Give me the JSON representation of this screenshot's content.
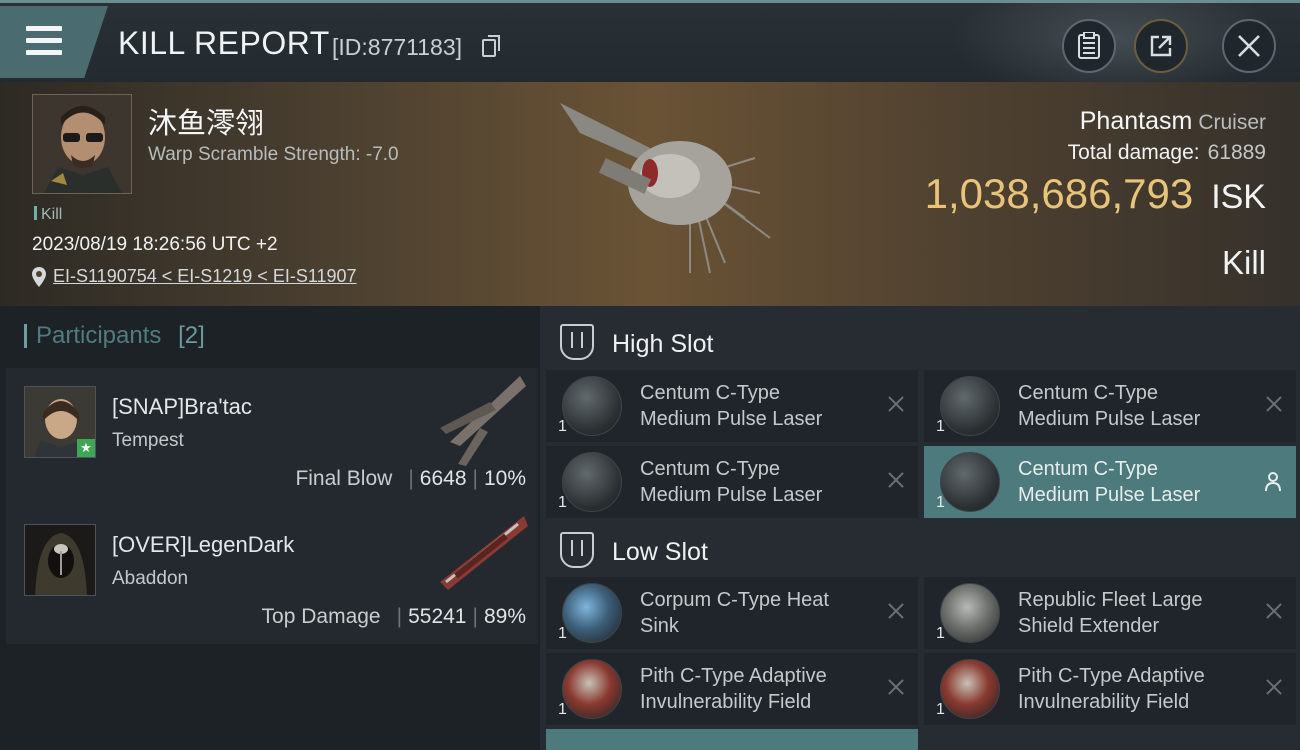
{
  "header": {
    "title": "KILL REPORT",
    "id_text": "[ID:8771183]",
    "icons": [
      "menu-icon",
      "clipboard-icon",
      "share-icon",
      "close-icon"
    ]
  },
  "victim": {
    "name": "沐鱼澪翎",
    "warp_scramble": "Warp Scramble Strength: -7.0",
    "tag": "Kill",
    "datetime": "2023/08/19 18:26:56 UTC +2",
    "location": "EI-S1190754 < EI-S1219 < EI-S11907",
    "ship": "Phantasm",
    "ship_class": "Cruiser",
    "total_damage_label": "Total damage:",
    "total_damage": "61889",
    "isk_value": "1,038,686,793",
    "isk_unit": "ISK",
    "result": "Kill"
  },
  "participants": {
    "label": "Participants",
    "count": "[2]",
    "rows": [
      {
        "name": "[SNAP]Bra'tac",
        "ship": "Tempest",
        "stat_label": "Final Blow",
        "damage": "6648",
        "percent": "10%"
      },
      {
        "name": "[OVER]LegenDark",
        "ship": "Abaddon",
        "stat_label": "Top Damage",
        "damage": "55241",
        "percent": "89%"
      }
    ]
  },
  "slots": {
    "high": {
      "label": "High Slot",
      "items": [
        {
          "qty": "1",
          "line1": "Centum C-Type",
          "line2": "Medium Pulse Laser"
        },
        {
          "qty": "1",
          "line1": "Centum C-Type",
          "line2": "Medium Pulse Laser"
        },
        {
          "qty": "1",
          "line1": "Centum C-Type",
          "line2": "Medium Pulse Laser"
        },
        {
          "qty": "1",
          "line1": "Centum C-Type",
          "line2": "Medium Pulse Laser"
        }
      ]
    },
    "low": {
      "label": "Low Slot",
      "items": [
        {
          "qty": "1",
          "line1": "Corpum C-Type Heat",
          "line2": "Sink"
        },
        {
          "qty": "1",
          "line1": "Republic Fleet Large",
          "line2": "Shield Extender"
        },
        {
          "qty": "1",
          "line1": "Pith C-Type Adaptive",
          "line2": "Invulnerability Field"
        },
        {
          "qty": "1",
          "line1": "Pith C-Type Adaptive",
          "line2": "Invulnerability Field"
        }
      ]
    }
  },
  "colors": {
    "accent": "#4d7a7c",
    "isk": "#e8c47a",
    "star_badge": "#3fa655"
  }
}
